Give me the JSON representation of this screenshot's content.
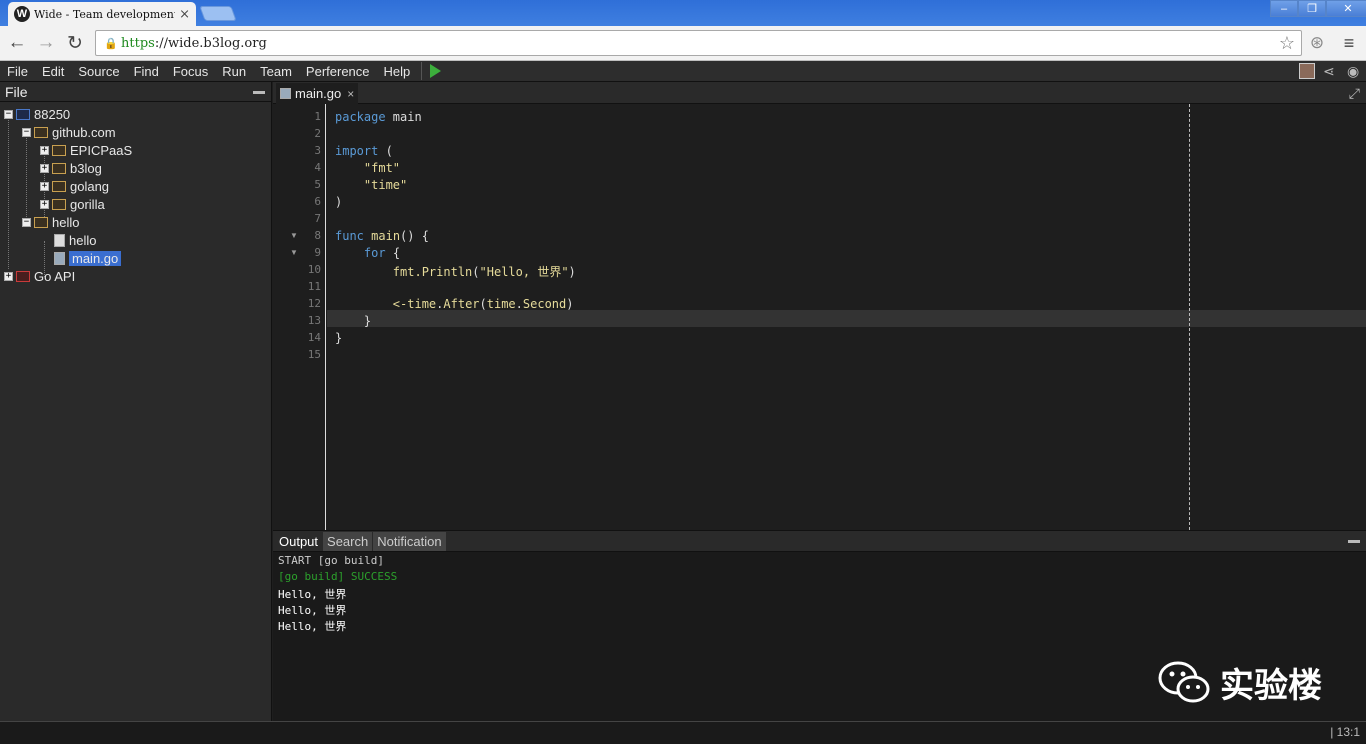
{
  "browser": {
    "tab_favicon": "W",
    "tab_title": "Wide - Team development",
    "tab_close": "×",
    "url_scheme": "https",
    "url_rest": "://wide.b3log.org",
    "window_buttons": [
      "‒",
      "❐",
      "✕"
    ]
  },
  "menu": {
    "items": [
      "File",
      "Edit",
      "Source",
      "Find",
      "Focus",
      "Run",
      "Team",
      "Perference",
      "Help"
    ]
  },
  "file_panel": {
    "title": "File",
    "tree": [
      {
        "label": "88250"
      },
      {
        "label": "github.com"
      },
      {
        "label": "EPICPaaS"
      },
      {
        "label": "b3log"
      },
      {
        "label": "golang"
      },
      {
        "label": "gorilla"
      },
      {
        "label": "hello"
      },
      {
        "label": "hello"
      },
      {
        "label": "main.go"
      },
      {
        "label": "Go API"
      }
    ]
  },
  "editor": {
    "tab_label": "main.go",
    "tab_close": "×",
    "line_numbers": [
      "1",
      "2",
      "3",
      "4",
      "5",
      "6",
      "7",
      "8",
      "9",
      "10",
      "11",
      "12",
      "13",
      "14",
      "15"
    ],
    "cursor_line": 13
  },
  "output": {
    "tabs": [
      "Output",
      "Search",
      "Notification"
    ],
    "lines": [
      "START [go build]",
      "[go build] SUCCESS",
      "Hello, 世界",
      "Hello, 世界",
      "Hello, 世界"
    ]
  },
  "watermark": {
    "text": "实验楼"
  },
  "status": {
    "position": "| 13:1"
  }
}
